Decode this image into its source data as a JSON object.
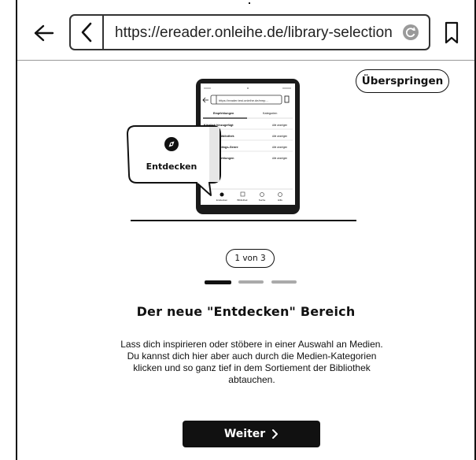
{
  "browser": {
    "url": "https://ereader.onleihe.de/library-selection",
    "icons": {
      "back": "arrow-left-icon",
      "url_back": "chevron-left-icon",
      "reload": "reload-icon",
      "bookmark": "bookmark-icon"
    }
  },
  "onboarding": {
    "skip_label": "Überspringen",
    "bubble_label": "Entdecken",
    "bubble_icon": "compass-icon",
    "page_indicator": "1 von 3",
    "current_step": 1,
    "total_steps": 3,
    "headline": "Der neue \"Entdecken\" Bereich",
    "description_lines": [
      "Lass dich inspirieren oder stöbere in einer Auswahl an Medien.",
      "Du kannst dich hier aber auch durch die Medien-Kategorien",
      "klicken und so ganz tief in dem Sortiement der Bibliothek",
      "abtauchen."
    ],
    "next_label": "Weiter"
  },
  "device_mockup": {
    "tabs": [
      "Empfehlungen",
      "Kategorien"
    ],
    "rows": [
      {
        "title": "Kürzlich hinzugefügt",
        "action": "Alle anzeigen"
      },
      {
        "title": "ngs deiner Bibliothek",
        "action": "Alle anzeigen"
      },
      {
        "title": "ert vom Lieblings-Genre",
        "action": "Alle anzeigen"
      },
      {
        "title": "nliche Empfehlungen",
        "action": "Alle anzeigen"
      }
    ],
    "nav_items": [
      "Entdecken",
      "Bibliothek",
      "Suche",
      "Hilfe"
    ]
  },
  "colors": {
    "ink": "#111111",
    "inactive_dot": "#aaaaaa",
    "background": "#ffffff"
  }
}
